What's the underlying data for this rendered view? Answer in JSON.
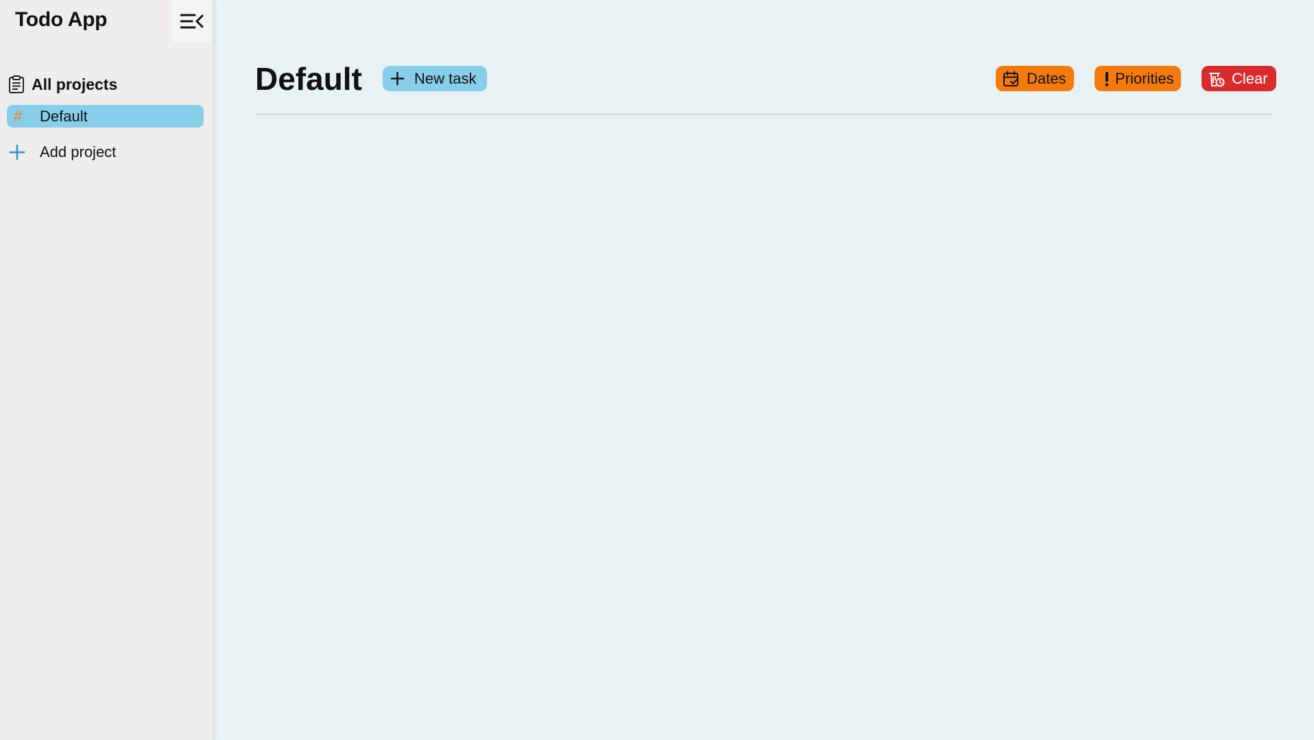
{
  "sidebar": {
    "app_title": "Todo App",
    "collapse_icon": "menu-collapse-icon",
    "all_projects_label": "All projects",
    "all_projects_icon": "clipboard-icon",
    "projects": [
      {
        "label": "Default",
        "icon": "hash-icon",
        "active": true
      }
    ],
    "add_project_label": "Add project",
    "add_project_icon": "plus-icon"
  },
  "main": {
    "title": "Default",
    "new_task_label": "New task",
    "filters": {
      "dates_label": "Dates",
      "priorities_label": "Priorities",
      "clear_label": "Clear"
    }
  },
  "colors": {
    "sidebar_bg": "#efedee",
    "main_bg": "#e8f1f3",
    "accent_blue": "#87ceeb",
    "orange": "#f47a0d",
    "red": "#d92b2b",
    "hash_orange": "#e8872b",
    "plus_blue": "#2a8fc9"
  }
}
